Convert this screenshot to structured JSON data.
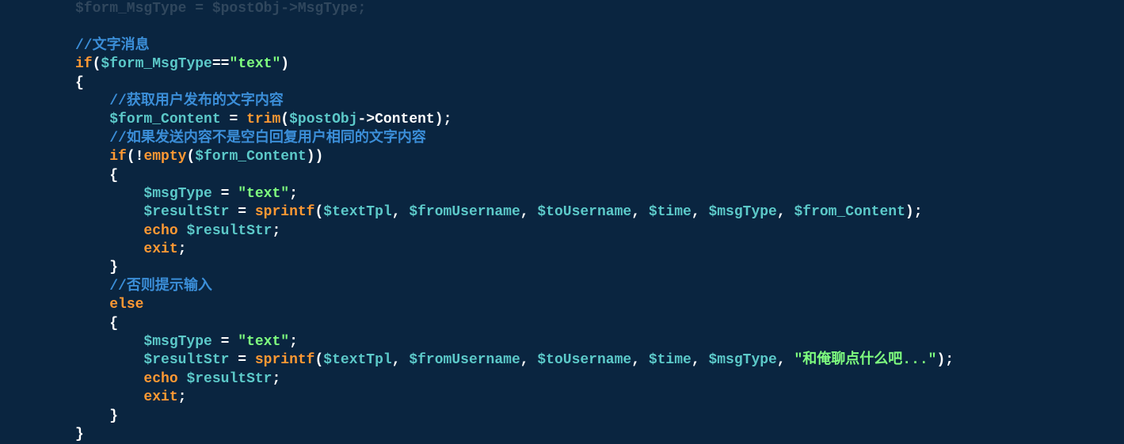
{
  "code": {
    "top_faded": "$form_MsgType = $postObj->MsgType;",
    "c1": "//文字消息",
    "kw_if": "if",
    "var_formMsgType": "$form_MsgType",
    "op_eq": "==",
    "str_text": "\"text\"",
    "brace_open": "{",
    "brace_close": "}",
    "c2": "//获取用户发布的文字内容",
    "var_formContent": "$form_Content",
    "op_assign": " = ",
    "fn_trim": "trim",
    "paren_open": "(",
    "paren_close": ")",
    "var_postObj": "$postObj",
    "arrow": "->",
    "prop_Content": "Content",
    "semi": ";",
    "c3": "//如果发送内容不是空白回复用户相同的文字内容",
    "op_not": "!",
    "fn_empty": "empty",
    "var_msgType": "$msgType",
    "var_resultStr": "$resultStr",
    "fn_sprintf": "sprintf",
    "var_textTpl": "$textTpl",
    "var_fromUsername": "$fromUsername",
    "var_toUsername": "$toUsername",
    "var_time": "$time",
    "var_fromContent": "$from_Content",
    "comma": ", ",
    "kw_echo": "echo",
    "kw_exit": "exit",
    "c4": "//否则提示输入",
    "kw_else": "else",
    "str_chat": "\"和俺聊点什么吧...\""
  }
}
